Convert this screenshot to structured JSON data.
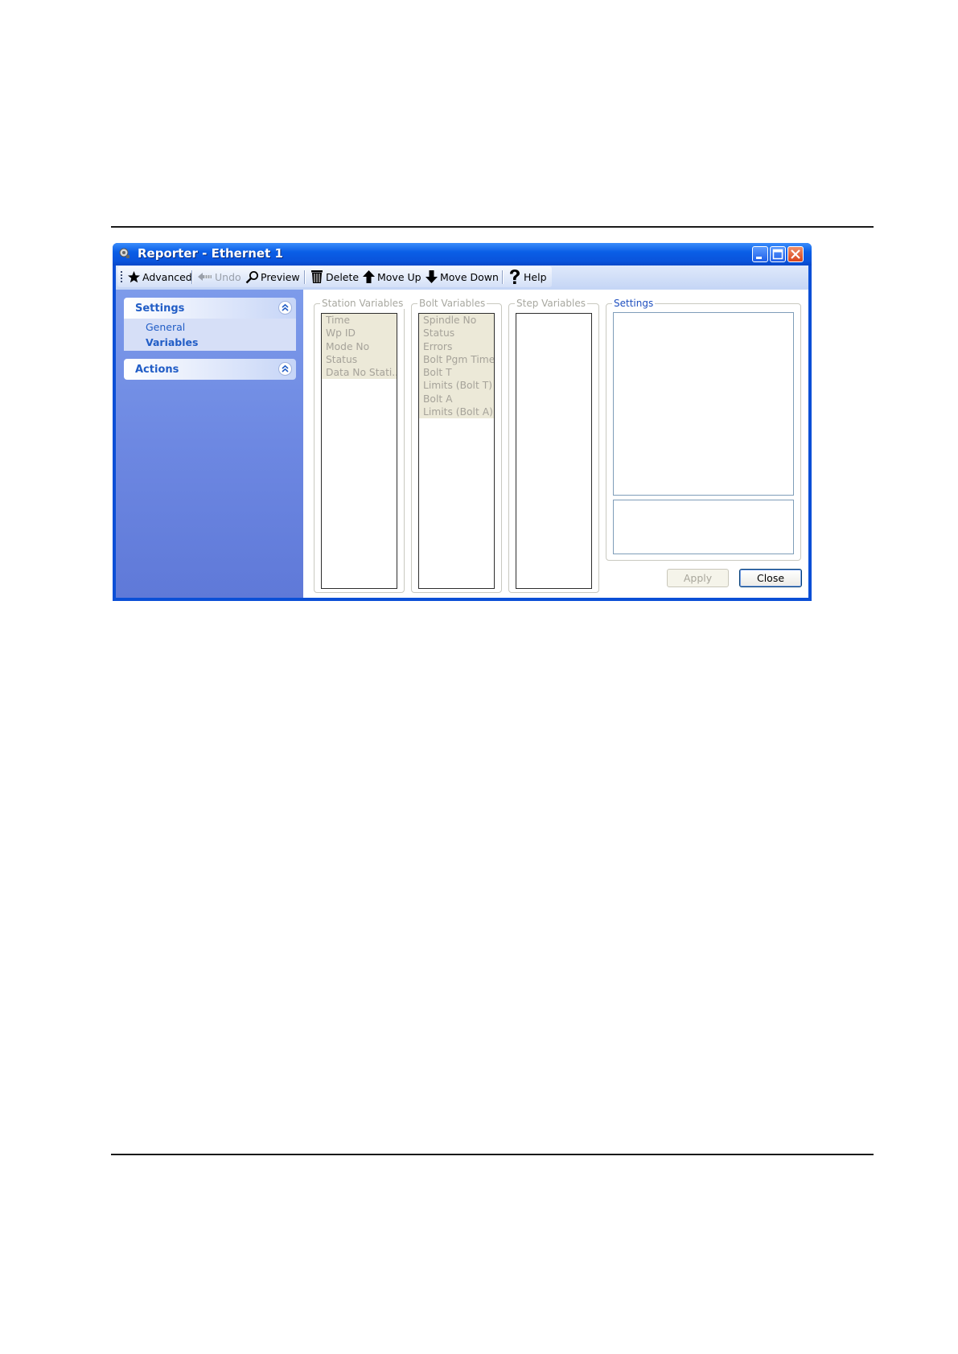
{
  "window": {
    "title": "Reporter - Ethernet 1"
  },
  "toolbar": {
    "advanced": "Advanced",
    "undo": "Undo",
    "preview": "Preview",
    "delete": "Delete",
    "move_up": "Move Up",
    "move_down": "Move Down",
    "help": "Help"
  },
  "sidebar": {
    "settings_title": "Settings",
    "settings_items": [
      "General",
      "Variables"
    ],
    "actions_title": "Actions"
  },
  "groups": {
    "station": {
      "label": "Station Variables",
      "items": [
        "Time",
        "Wp ID",
        "Mode No",
        "Status",
        "Data No Stati..."
      ]
    },
    "bolt": {
      "label": "Bolt Variables",
      "items": [
        "Spindle No",
        "Status",
        "Errors",
        "Bolt Pgm Time",
        "Bolt T",
        "Limits (Bolt T)",
        "Bolt A",
        "Limits (Bolt A)"
      ]
    },
    "step": {
      "label": "Step Variables",
      "items": []
    },
    "settings": {
      "label": "Settings"
    }
  },
  "buttons": {
    "apply": "Apply",
    "close": "Close"
  },
  "colors": {
    "titlebar": "#0a5ee6",
    "sidebar": "#6d88e2",
    "link": "#215dc6",
    "list_background": "#ece9d8"
  }
}
